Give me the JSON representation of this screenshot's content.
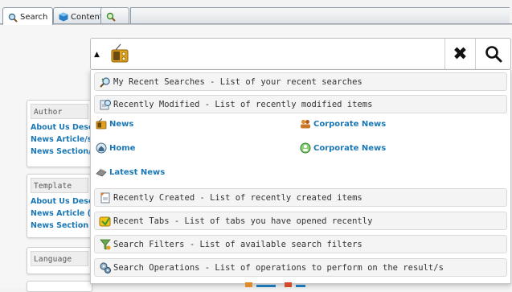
{
  "tabs": [
    {
      "label": "Search",
      "icon": "magnifier-icon",
      "active": true
    },
    {
      "label": "Content",
      "icon": "cube-icon",
      "active": false
    },
    {
      "label": "",
      "icon": "magnifier-extra-icon",
      "active": false
    }
  ],
  "search_bar": {
    "scope_icon": "radio-icon",
    "clear_icon": "close-icon",
    "search_icon": "search-icon"
  },
  "sidebar": [
    {
      "header": "Author",
      "links": [
        "About Us Desc",
        "News Article/s",
        "News Section/"
      ]
    },
    {
      "header": "Template",
      "links": [
        "About Us Desc",
        "News Article (",
        "News Section ("
      ]
    },
    {
      "header": "Language",
      "links": []
    }
  ],
  "menu_top": [
    {
      "label": "My Recent Searches - List of your recent searches",
      "icon": "recent-searches-icon"
    },
    {
      "label": "Recently Modified - List of recently modified items",
      "icon": "recently-modified-icon"
    }
  ],
  "quick_links": [
    {
      "label": "News",
      "icon": "radio-icon"
    },
    {
      "label": "Corporate News",
      "icon": "people-icon"
    },
    {
      "label": "Home",
      "icon": "home-icon"
    },
    {
      "label": "Corporate News",
      "icon": "globe-people-icon"
    },
    {
      "label": "Latest News",
      "icon": "bookmark-icon"
    }
  ],
  "menu_bottom": [
    {
      "label": "Recently Created - List of recently created items",
      "icon": "recently-created-icon"
    },
    {
      "label": "Recent Tabs - List of tabs you have opened recently",
      "icon": "recent-tabs-icon"
    },
    {
      "label": "Search Filters - List of available search filters",
      "icon": "filter-icon"
    },
    {
      "label": "Search Operations - List of operations to perform on the result/s",
      "icon": "operations-icon"
    }
  ],
  "colors": {
    "link": "#1b78b5",
    "panel": "#f6f6f6",
    "menu_item_bg": "#f4f4f4"
  }
}
